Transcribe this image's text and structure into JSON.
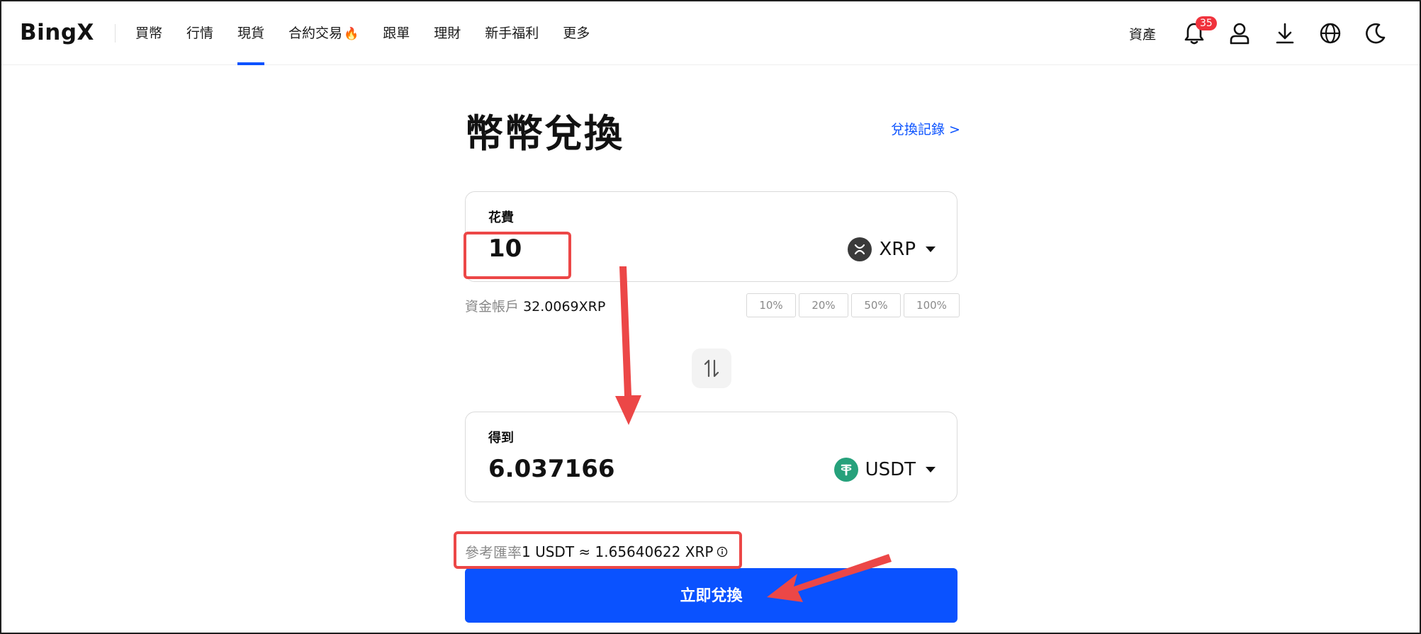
{
  "header": {
    "logo": "BingX",
    "nav": [
      {
        "label": "買幣",
        "active": false
      },
      {
        "label": "行情",
        "active": false
      },
      {
        "label": "現貨",
        "active": true
      },
      {
        "label": "合約交易",
        "active": false,
        "icon": "fire-icon"
      },
      {
        "label": "跟單",
        "active": false
      },
      {
        "label": "理財",
        "active": false
      },
      {
        "label": "新手福利",
        "active": false
      },
      {
        "label": "更多",
        "active": false
      }
    ],
    "assets_label": "資產",
    "notification_count": "35",
    "icons": [
      "bell-icon",
      "user-icon",
      "download-icon",
      "globe-icon",
      "moon-icon"
    ]
  },
  "page": {
    "title": "幣幣兌換",
    "history_link": "兌換記錄 >"
  },
  "spend": {
    "label": "花費",
    "amount": "10",
    "coin": "XRP",
    "coin_color": "#3a3a3a"
  },
  "balance": {
    "label": "資金帳戶",
    "value": "32.0069XRP"
  },
  "percent_buttons": [
    "10%",
    "20%",
    "50%",
    "100%"
  ],
  "receive": {
    "label": "得到",
    "amount": "6.037166",
    "coin": "USDT",
    "coin_color": "#26a17b"
  },
  "rate": {
    "label": "參考匯率",
    "value": "1 USDT ≈ 1.65640622 XRP"
  },
  "convert_button": "立即兌換",
  "colors": {
    "accent": "#0a52ff",
    "annotation": "#ec4747",
    "badge": "#f0323c"
  }
}
